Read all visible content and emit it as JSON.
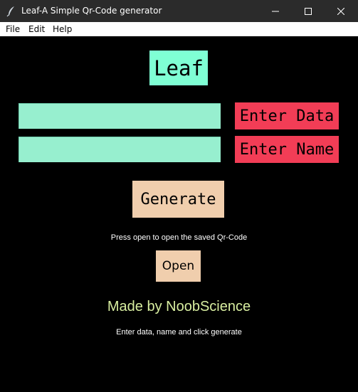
{
  "window": {
    "title": "Leaf-A Simple Qr-Code generator",
    "icon": "feather-icon"
  },
  "menu": {
    "items": [
      {
        "label": "File"
      },
      {
        "label": "Edit"
      },
      {
        "label": "Help"
      }
    ]
  },
  "main": {
    "logo": "Leaf",
    "data_field": {
      "value": "",
      "placeholder": ""
    },
    "name_field": {
      "value": "",
      "placeholder": ""
    },
    "data_label": "Enter Data",
    "name_label": "Enter Name",
    "generate_label": "Generate",
    "open_hint": "Press open to open the saved Qr-Code",
    "open_label": "Open",
    "credit": "Made by NoobScience",
    "bottom_hint": "Enter data, name and click generate"
  },
  "colors": {
    "background": "#000000",
    "logo_bg": "#7fffd4",
    "field_bg": "#97efcf",
    "label_bg": "#f23d56",
    "button_bg": "#f0cead",
    "credit_text": "#d8eea0"
  }
}
